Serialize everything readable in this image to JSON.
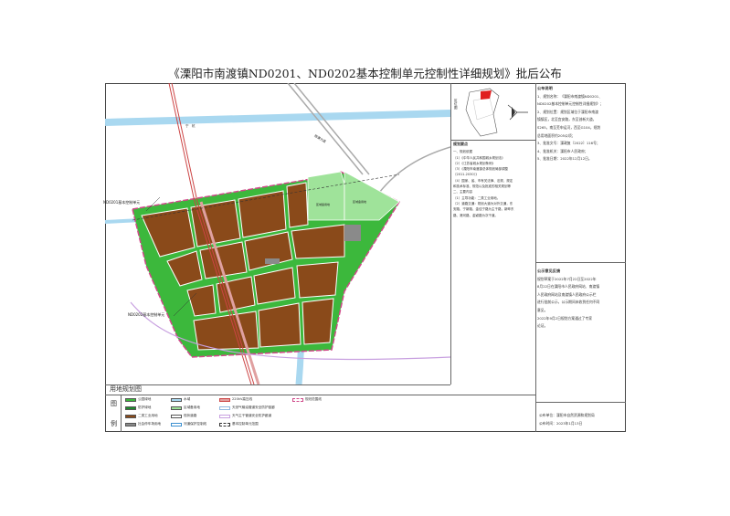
{
  "title": "《溧阳市南渡镇ND0201、ND0202基本控制单元控制性详细规划》批后公布",
  "map": {
    "caption": "用地规划图",
    "unit1_label": "ND0201基本控制单元",
    "unit2_label": "ND0202基本控制单元",
    "road_top": "宁　杭",
    "road_diag": "扬溧大道",
    "parcel_green1": "区域备用地",
    "parcel_green2": "区域备用地",
    "parcel_code": "M2"
  },
  "locmap": {
    "label": "区位图"
  },
  "legend": {
    "title_a": "图",
    "title_b": "例",
    "items": [
      {
        "label": "公园绿地",
        "color": "#3cb83c"
      },
      {
        "label": "防护绿地",
        "color": "#1f8a2e"
      },
      {
        "label": "二类工业用地",
        "color": "#8a4a1a"
      },
      {
        "label": "社会停车场用地",
        "color": "#8a8a8a"
      },
      {
        "label": "水域",
        "color": "#a9d8f0"
      },
      {
        "label": "区域备用地",
        "color": "#9fe39a"
      },
      {
        "label": "现状道路",
        "color": "#ffffff"
      },
      {
        "label": "河道保护控制线",
        "color": "#ffffff"
      },
      {
        "label": "220kV高压线",
        "color": "#e0a0a0"
      },
      {
        "label": "天然气输油管道安全防护链廊",
        "color": "#ffffff"
      },
      {
        "label": "天气主干管道安全防护廊道",
        "color": "#ffffff"
      },
      {
        "label": "基本控制单元范围",
        "color": "#ffffff"
      },
      {
        "label": "规划范围线",
        "color": "#ffffff"
      }
    ]
  },
  "notes": {
    "heading": "规划要点",
    "lines": [
      "一、规划依据",
      "（1）《中华人民共和国城乡规划法》",
      "（2）《江苏省城乡规划条例》",
      "（3）《溧阳市南渡镇总体规划局部调整",
      "（2011-2030）》",
      "（4）国家、省、市有关法律、法规、规定",
      "和技术标准、规范以及批准的相关规划等",
      "二、主要内容",
      "（1）主导功能：二类工业用地。",
      "（2）道路交通：规划大道为对外交通，东",
      "安路、宁新路、金佳宁路为主干路，新畔东",
      "路、港河路、金颖路为次干道。"
    ]
  },
  "announce": {
    "heading": "公布说明",
    "lines": [
      "1、规划名称：《溧阳市南渡镇ND0201、",
      "ND0202基本控制单元控制性详细规划》；",
      "2、规划位置：规划区域位于溧阳市南渡",
      "镇镇区，北至宜安路，东至创新大道，",
      "S265，南至芜申运河，西至G104，规划",
      "总用地面积约205公顷；",
      "3、批准文号：溧政复〔2022〕116号；",
      "4、批准机关：溧阳市人民政府；",
      "5、批准日期：2022年12月12日。"
    ]
  },
  "opinion": {
    "heading": "公示意见反馈",
    "lines": [
      "规划草案于2022年7月22日至2022年",
      "8月22日在溧阳市人民政府网站、南渡镇",
      "人民政府网站及南渡镇人民政府公示栏",
      "进行批前公示，公示期间未收到任何不同",
      "意见。",
      "2022年9月2日规划方案通过了专家",
      "论证。"
    ]
  },
  "publisher": {
    "unit": "公布单位：溧阳市自然资源和规划局",
    "date": "公布时间：2023年1月13日"
  }
}
